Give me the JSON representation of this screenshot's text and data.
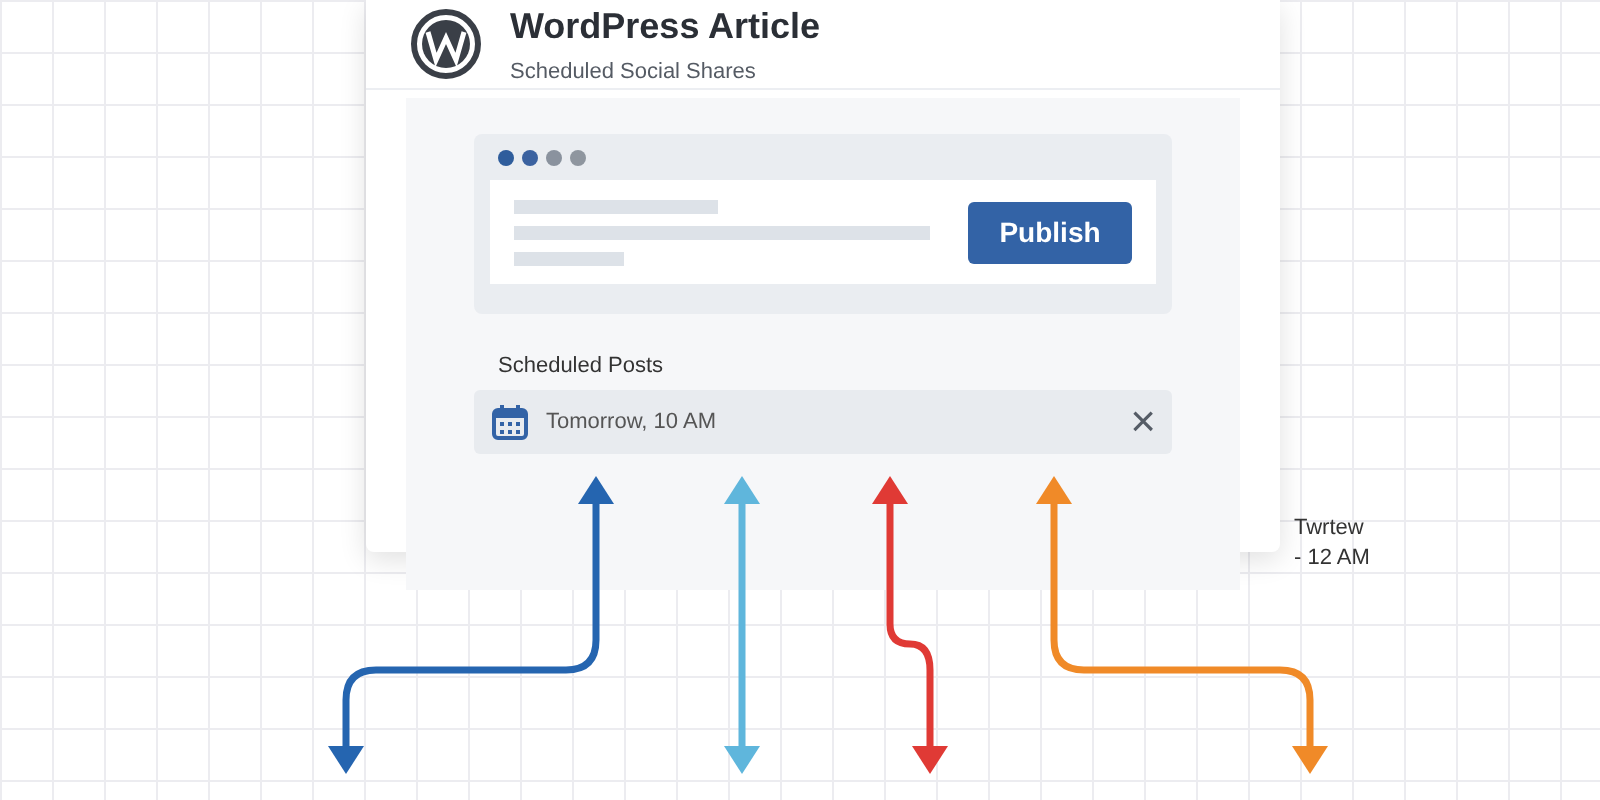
{
  "card": {
    "title": "WordPress Article",
    "subtitle": "Scheduled Social Shares"
  },
  "editor": {
    "dots": [
      {
        "color": "#2f5d9c"
      },
      {
        "color": "#3b62a0"
      },
      {
        "color": "#8a929e"
      },
      {
        "color": "#8f969f"
      }
    ],
    "button": "Publish"
  },
  "scheduled": {
    "label": "Scheduled Posts",
    "value": "Tomorrow, 10 AM",
    "clear": "×"
  },
  "note": [
    "Twrtew",
    "- 12 AM"
  ],
  "arrows": [
    {
      "kind": "elbow-left",
      "color": "#2565b0"
    },
    {
      "kind": "straight",
      "color": "#5fb6dc"
    },
    {
      "kind": "jog",
      "color": "#e03a35"
    },
    {
      "kind": "elbow-right",
      "color": "#f08a28"
    }
  ]
}
